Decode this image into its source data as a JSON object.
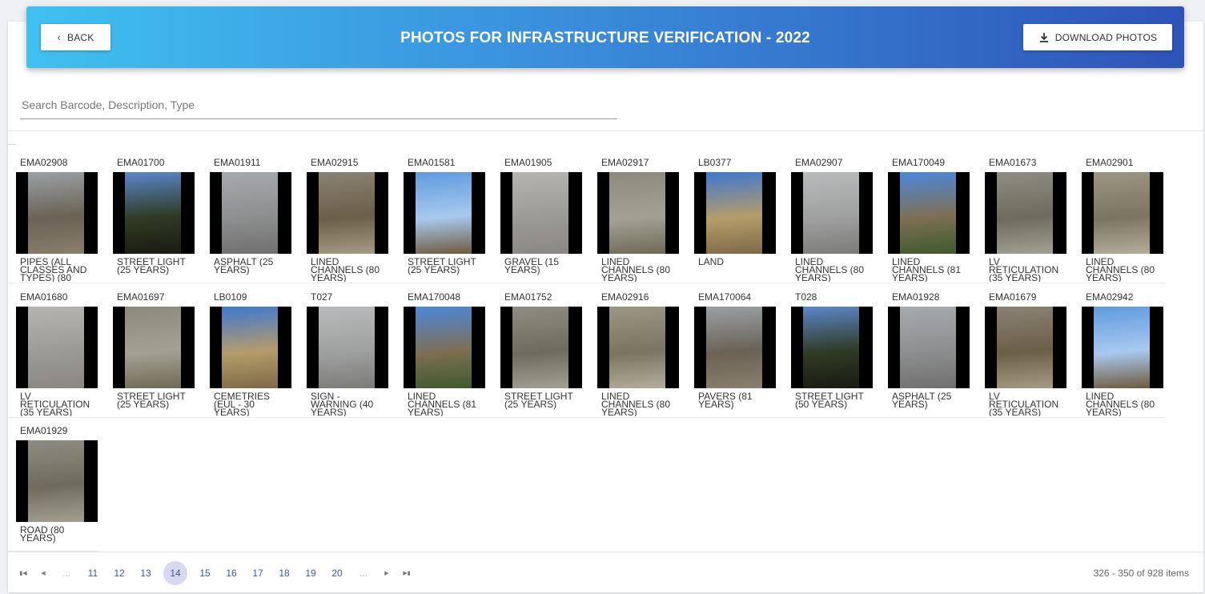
{
  "header": {
    "title": "PHOTOS FOR INFRASTRUCTURE VERIFICATION - 2022",
    "back_label": "BACK",
    "download_label": "DOWNLOAD PHOTOS"
  },
  "search": {
    "placeholder": "Search Barcode, Description, Type",
    "value": ""
  },
  "rows": [
    [
      {
        "code": "EMA02908",
        "desc": "PIPES (ALL CLASSES AND TYPES) (80"
      },
      {
        "code": "EMA01700",
        "desc": "STREET LIGHT (25 YEARS)"
      },
      {
        "code": "EMA01911",
        "desc": "ASPHALT (25 YEARS)"
      },
      {
        "code": "EMA02915",
        "desc": "LINED CHANNELS (80 YEARS)"
      },
      {
        "code": "EMA01581",
        "desc": "STREET LIGHT (25 YEARS)"
      },
      {
        "code": "EMA01905",
        "desc": "GRAVEL (15 YEARS)"
      },
      {
        "code": "EMA02917",
        "desc": "LINED CHANNELS (80 YEARS)"
      },
      {
        "code": "LB0377",
        "desc": "LAND"
      },
      {
        "code": "EMA02907",
        "desc": "LINED CHANNELS (80 YEARS)"
      },
      {
        "code": "EMA170049",
        "desc": "LINED CHANNELS (81 YEARS)"
      },
      {
        "code": "EMA01673",
        "desc": "LV RETICULATION (35 YEARS)"
      },
      {
        "code": "EMA02901",
        "desc": "LINED CHANNELS (80 YEARS)"
      }
    ],
    [
      {
        "code": "EMA01680",
        "desc": "LV RETICULATION (35 YEARS)"
      },
      {
        "code": "EMA01697",
        "desc": "STREET LIGHT (25 YEARS)"
      },
      {
        "code": "LB0109",
        "desc": "CEMETRIES (EUL - 30 YEARS)"
      },
      {
        "code": "T027",
        "desc": "SIGN - WARNING (40 YEARS)"
      },
      {
        "code": "EMA170048",
        "desc": "LINED CHANNELS (81 YEARS)"
      },
      {
        "code": "EMA01752",
        "desc": "STREET LIGHT (25 YEARS)"
      },
      {
        "code": "EMA02916",
        "desc": "LINED CHANNELS (80 YEARS)"
      },
      {
        "code": "EMA170064",
        "desc": "PAVERS (81 YEARS)"
      },
      {
        "code": "T028",
        "desc": "STREET LIGHT (50 YEARS)"
      },
      {
        "code": "EMA01928",
        "desc": "ASPHALT (25 YEARS)"
      },
      {
        "code": "EMA01679",
        "desc": "LV RETICULATION (35 YEARS)"
      },
      {
        "code": "EMA02942",
        "desc": "LINED CHANNELS (80 YEARS)"
      }
    ],
    [
      {
        "code": "EMA01929",
        "desc": "ROAD (80 YEARS)"
      }
    ]
  ],
  "pager": {
    "first_icon": "first-page-icon",
    "prev_icon": "prev-page-icon",
    "next_icon": "next-page-icon",
    "last_icon": "last-page-icon",
    "ellipsis": "...",
    "pages": [
      "11",
      "12",
      "13",
      "14",
      "15",
      "16",
      "17",
      "18",
      "19",
      "20"
    ],
    "current": "14",
    "items_info": "326 - 350 of 928 items"
  },
  "colors": {
    "header_start": "#3fc1f0",
    "header_end": "#2e54b8",
    "accent": "#3f51b5",
    "active_page_bg": "#d6d9ef"
  }
}
